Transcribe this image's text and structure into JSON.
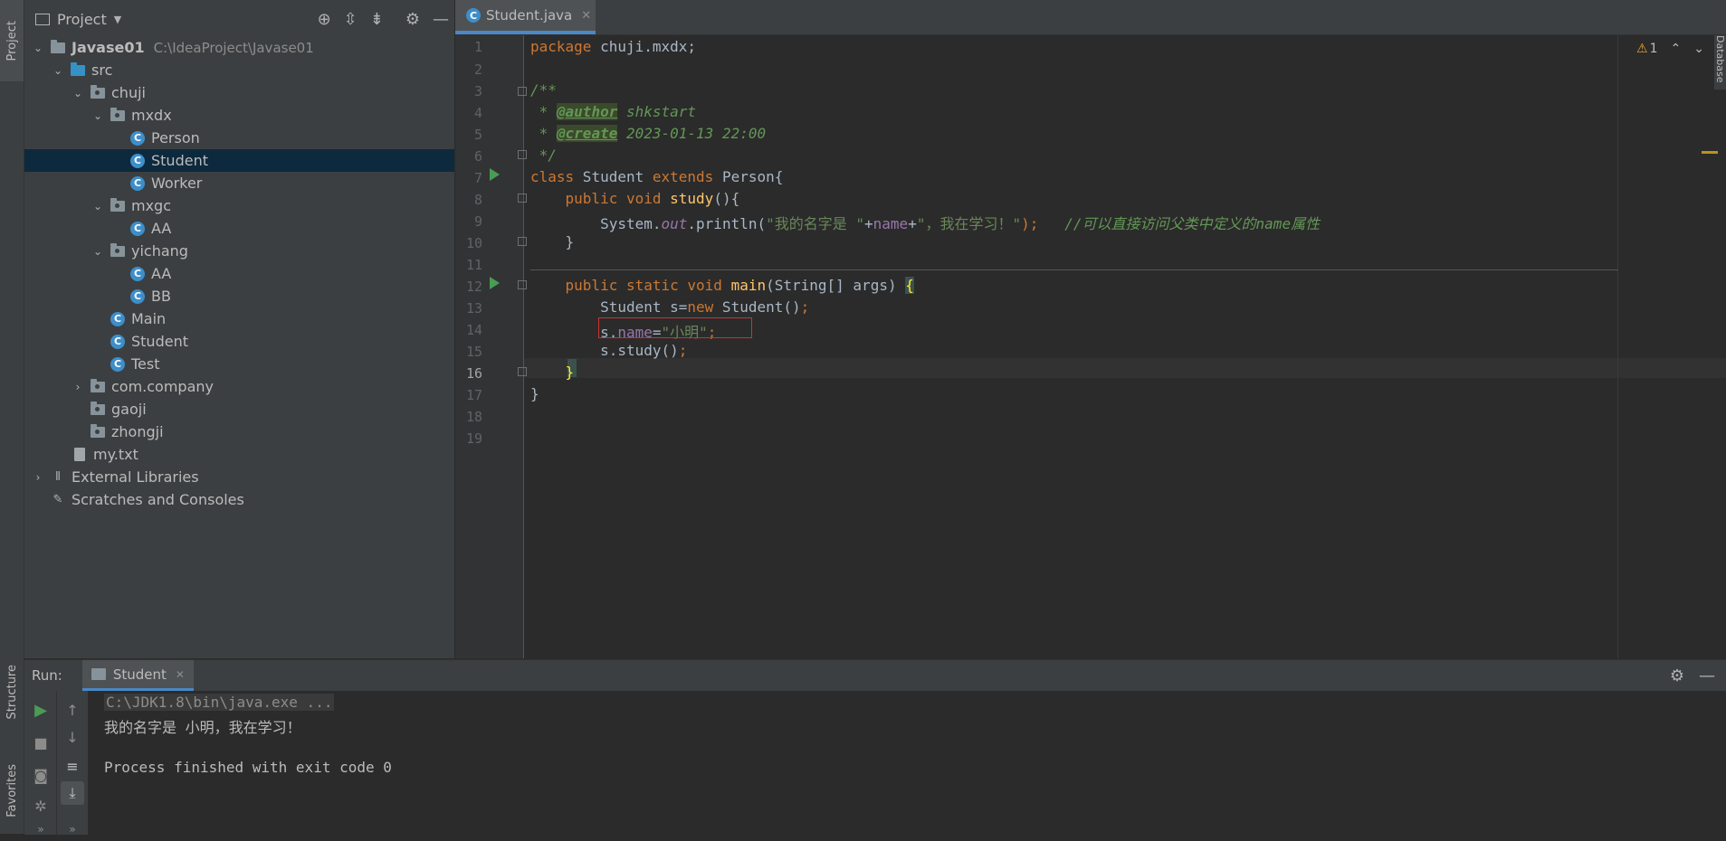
{
  "left_strip": {
    "project_tab": "Project",
    "structure_tab": "Structure",
    "favorites_tab": "Favorites"
  },
  "project_panel": {
    "title": "Project",
    "icons": [
      "locate-icon",
      "expand-all-icon",
      "collapse-all-icon",
      "gear-icon",
      "hide-icon"
    ],
    "tree": [
      {
        "label": "Javase01",
        "path": "C:\\IdeaProject\\Javase01"
      },
      {
        "label": "src"
      },
      {
        "label": "chuji"
      },
      {
        "label": "mxdx"
      },
      {
        "label": "Person"
      },
      {
        "label": "Student"
      },
      {
        "label": "Worker"
      },
      {
        "label": "mxgc"
      },
      {
        "label": "AA"
      },
      {
        "label": "yichang"
      },
      {
        "label": "AA"
      },
      {
        "label": "BB"
      },
      {
        "label": "Main"
      },
      {
        "label": "Student"
      },
      {
        "label": "Test"
      },
      {
        "label": "com.company"
      },
      {
        "label": "gaoji"
      },
      {
        "label": "zhongji"
      },
      {
        "label": "my.txt"
      },
      {
        "label": "External Libraries"
      },
      {
        "label": "Scratches and Consoles"
      }
    ]
  },
  "editor": {
    "tab": {
      "name": "Student.java",
      "icon": "C"
    },
    "line_numbers": [
      "1",
      "2",
      "3",
      "4",
      "5",
      "6",
      "7",
      "8",
      "9",
      "10",
      "11",
      "12",
      "13",
      "14",
      "15",
      "16",
      "17",
      "18",
      "19"
    ],
    "code": {
      "l1_kw": "package",
      "l1_rest": " chuji.mxdx;",
      "l3": "/**",
      "l4_pre": " * ",
      "l4_tag": "@author",
      "l4_val": " shkstart",
      "l5_pre": " * ",
      "l5_tag": "@create",
      "l5_val": " 2023-01-13 22:00",
      "l6": " */",
      "l7_kw": "class",
      "l7_name": " Student ",
      "l7_kw2": "extends",
      "l7_rest": " Person{",
      "l8_indent": "    ",
      "l8_kw": "public void",
      "l8_sp": " ",
      "l8_fn": "study",
      "l8_rest": "(){",
      "l9_indent": "        System.",
      "l9_out": "out",
      "l9_mid": ".println(",
      "l9_str1": "\"我的名字是 \"",
      "l9_plus1": "+",
      "l9_name": "name",
      "l9_plus2": "+",
      "l9_str2": "\"，我在学习！\"",
      "l9_end": ");",
      "l9_comment": "   //可以直接访问父类中定义的name属性",
      "l10": "    }",
      "l12_indent": "    ",
      "l12_kw": "public static void",
      "l12_sp": " ",
      "l12_fn": "main",
      "l12_rest": "(String[] args) ",
      "l12_brace": "{",
      "l13_indent": "        Student s=",
      "l13_kw": "new",
      "l13_rest": " Student()",
      "l13_semi": ";",
      "l14_indent": "        s.",
      "l14_fld": "name",
      "l14_eq": "=",
      "l14_str": "\"小明\"",
      "l14_semi": ";",
      "l15_indent": "        s.study()",
      "l15_semi": ";",
      "l16_indent": "    ",
      "l16_brace": "}",
      "l17": "}"
    },
    "inspections": {
      "warning_count": "1"
    }
  },
  "database_tab": "Database",
  "run_panel": {
    "label": "Run:",
    "tab_name": "Student",
    "console": [
      "C:\\JDK1.8\\bin\\java.exe ...",
      "我的名字是 小明，我在学习！",
      "",
      "Process finished with exit code 0"
    ]
  },
  "colors": {
    "accent": "#4a88c7",
    "keyword": "#cc7832",
    "string": "#6a8759",
    "comment": "#629755",
    "function": "#ffc66d",
    "field": "#9876aa",
    "run": "#499c54",
    "highlight_box": "#d0312d"
  }
}
